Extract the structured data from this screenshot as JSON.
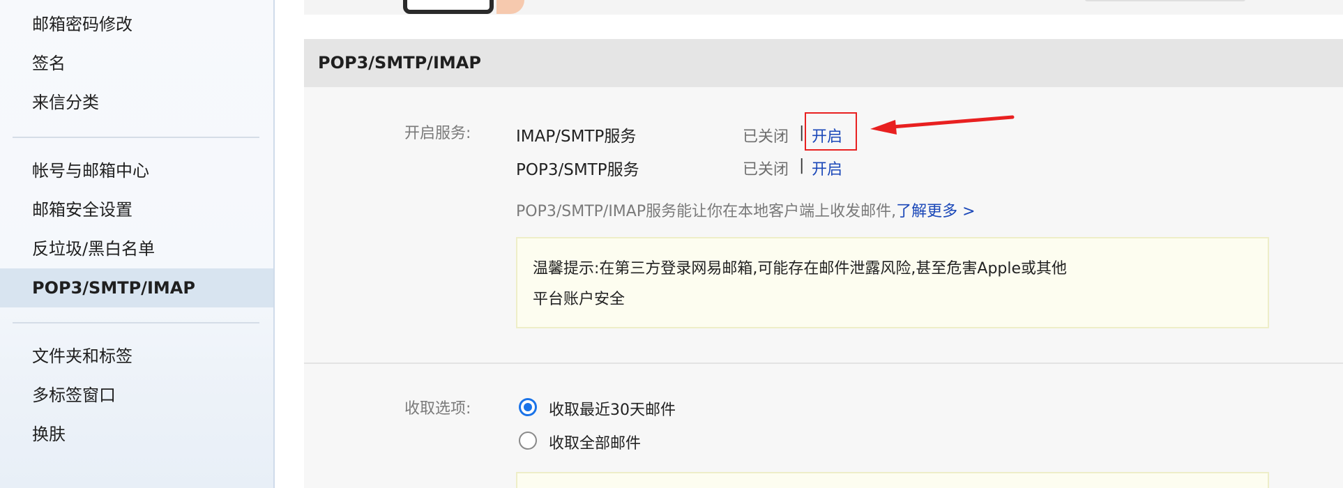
{
  "sidebar": {
    "items": [
      {
        "label": "邮箱密码修改"
      },
      {
        "label": "签名"
      },
      {
        "label": "来信分类"
      },
      {
        "label": "帐号与邮箱中心"
      },
      {
        "label": "邮箱安全设置"
      },
      {
        "label": "反垃圾/黑白名单"
      },
      {
        "label": "POP3/SMTP/IMAP"
      },
      {
        "label": "文件夹和标签"
      },
      {
        "label": "多标签窗口"
      },
      {
        "label": "换肤"
      }
    ],
    "active_index": 6
  },
  "section": {
    "title": "POP3/SMTP/IMAP",
    "services_label": "开启服务:",
    "services": [
      {
        "name": "IMAP/SMTP服务",
        "status": "已关闭",
        "separator": "|",
        "action": "开启"
      },
      {
        "name": "POP3/SMTP服务",
        "status": "已关闭",
        "separator": "|",
        "action": "开启"
      }
    ],
    "description": "POP3/SMTP/IMAP服务能让你在本地客户端上收发邮件,",
    "learn_more": "了解更多 >",
    "notice_line1": "温馨提示:在第三方登录网易邮箱,可能存在邮件泄露风险,甚至危害Apple或其他",
    "notice_line2": "平台账户安全",
    "fetch_label": "收取选项:",
    "fetch_options": [
      {
        "label": "收取最近30天邮件",
        "checked": true
      },
      {
        "label": "收取全部邮件",
        "checked": false
      }
    ]
  },
  "colors": {
    "accent": "#1a73e8",
    "link": "#1a47b8",
    "highlight": "#e82020",
    "active_sidebar_bg": "#d8e4f0",
    "header_bg": "#e5e5e5",
    "notice_bg": "#fdfdf0"
  }
}
